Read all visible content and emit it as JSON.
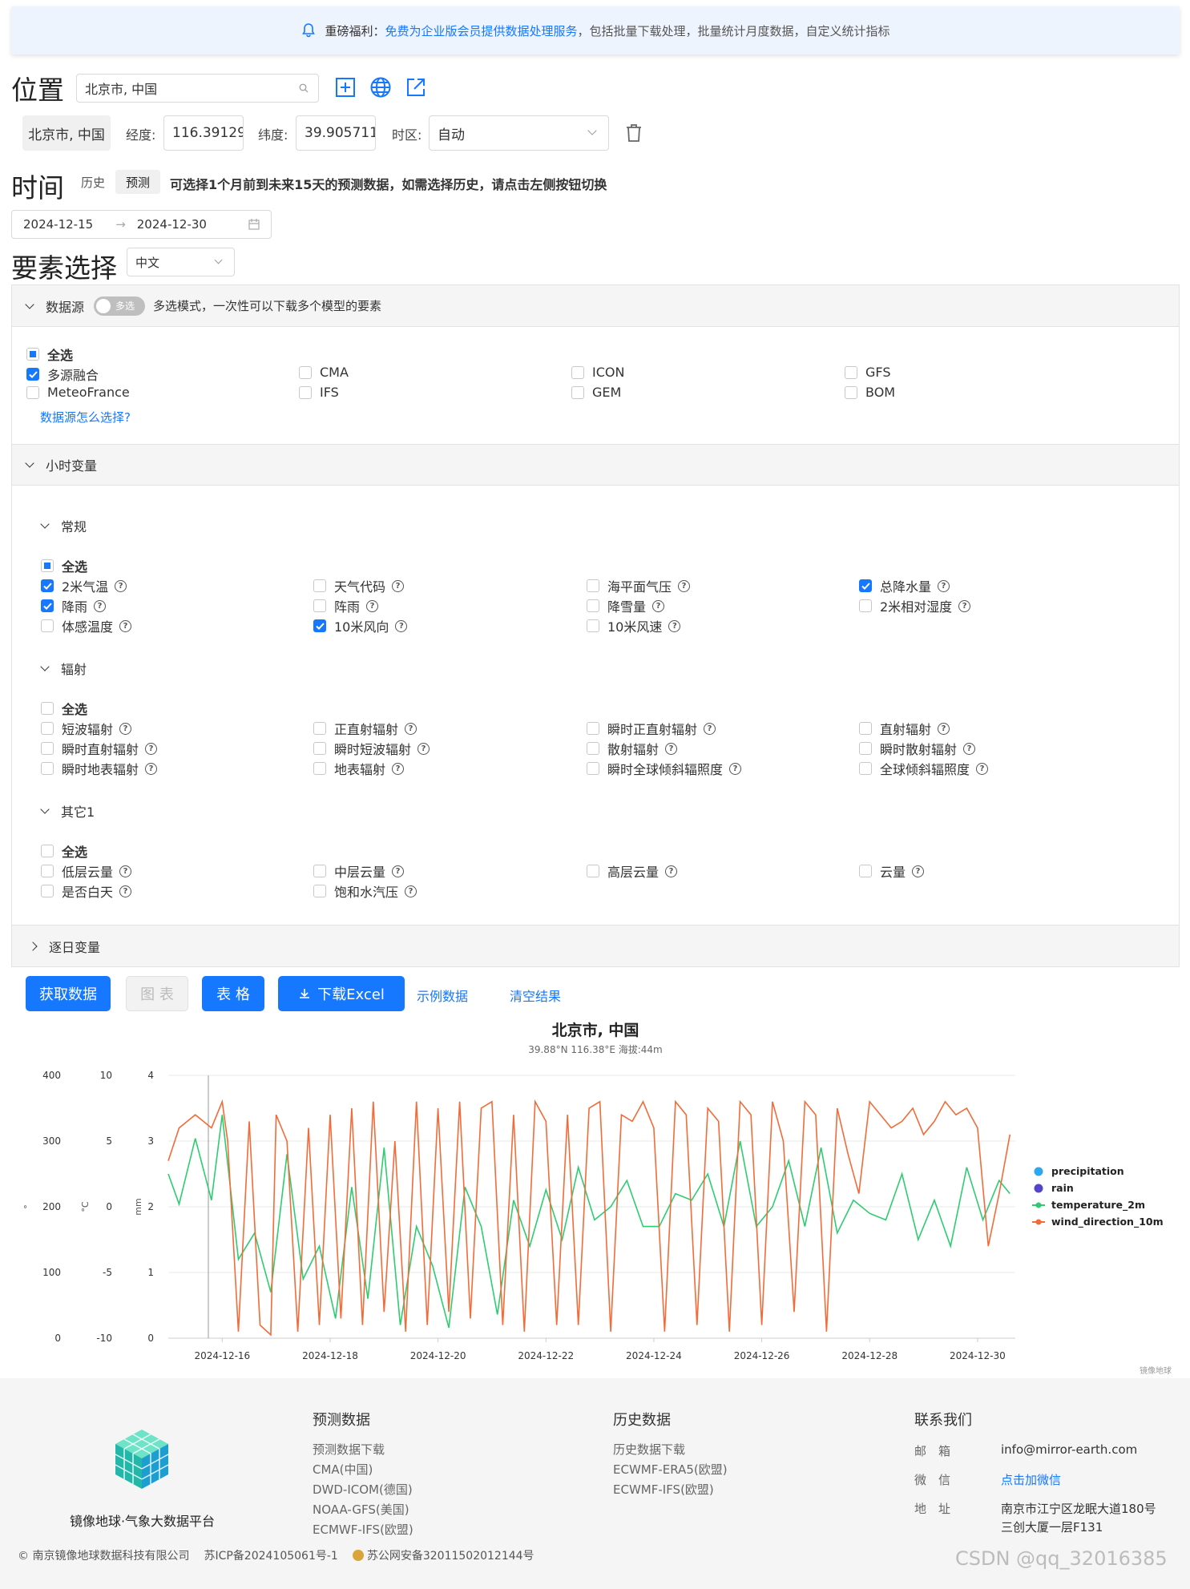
{
  "notice": {
    "lead": "重磅福利：",
    "highlight": "免费为企业版会员提供数据处理服务",
    "rest": "，包括批量下载处理，批量统计月度数据，自定义统计指标"
  },
  "location": {
    "title": "位置",
    "search_value": "北京市, 中国",
    "chip": "北京市, 中国",
    "lon_label": "经度:",
    "lon_value": "116.39129",
    "lat_label": "纬度:",
    "lat_value": "39.905711",
    "tz_label": "时区:",
    "tz_value": "自动"
  },
  "time": {
    "title": "时间",
    "tab_history": "历史",
    "tab_forecast": "预测",
    "hint": "可选择1个月前到未来15天的预测数据，如需选择历史，请点击左侧按钮切换",
    "start": "2024-12-15",
    "end": "2024-12-30",
    "arrow": "→"
  },
  "elements": {
    "title": "要素选择",
    "lang": "中文"
  },
  "datasource": {
    "title": "数据源",
    "toggle": "多选",
    "desc": "多选模式，一次性可以下载多个模型的要素",
    "select_all": "全选",
    "items": [
      "多源融合",
      "CMA",
      "ICON",
      "GFS",
      "MeteoFrance",
      "IFS",
      "GEM",
      "BOM"
    ],
    "help_link": "数据源怎么选择?"
  },
  "hourly": {
    "title": "小时变量",
    "general": {
      "title": "常规",
      "select_all": "全选",
      "items": [
        "2米气温",
        "天气代码",
        "海平面气压",
        "总降水量",
        "降雨",
        "阵雨",
        "降雪量",
        "2米相对湿度",
        "体感温度",
        "10米风向",
        "10米风速"
      ]
    },
    "radiation": {
      "title": "辐射",
      "select_all": "全选",
      "items": [
        "短波辐射",
        "正直射辐射",
        "瞬时正直射辐射",
        "直射辐射",
        "瞬时直射辐射",
        "瞬时短波辐射",
        "散射辐射",
        "瞬时散射辐射",
        "瞬时地表辐射",
        "地表辐射",
        "瞬时全球倾斜辐照度",
        "全球倾斜辐照度"
      ]
    },
    "other": {
      "title": "其它1",
      "select_all": "全选",
      "items": [
        "低层云量",
        "中层云量",
        "高层云量",
        "云量",
        "是否白天",
        "饱和水汽压"
      ]
    }
  },
  "daily": {
    "title": "逐日变量"
  },
  "actions": {
    "fetch": "获取数据",
    "chart": "图 表",
    "table": "表 格",
    "download": "下载Excel",
    "sample": "示例数据",
    "clear": "清空结果"
  },
  "chart_data": {
    "type": "line",
    "title": "北京市, 中国",
    "subtitle": "39.88°N 116.38°E 海拔:44m",
    "x_ticks": [
      "2024-12-16",
      "2024-12-18",
      "2024-12-20",
      "2024-12-22",
      "2024-12-24",
      "2024-12-26",
      "2024-12-28",
      "2024-12-30"
    ],
    "axes": [
      {
        "unit": "°",
        "ticks": [
          "400",
          "300",
          "200",
          "100",
          "0"
        ],
        "range": [
          0,
          400
        ]
      },
      {
        "unit": "°C",
        "ticks": [
          "10",
          "5",
          "0",
          "-5",
          "-10"
        ],
        "range": [
          -10,
          10
        ]
      },
      {
        "unit": "mm",
        "ticks": [
          "4",
          "3",
          "2",
          "1",
          "0"
        ],
        "range": [
          0,
          4
        ]
      }
    ],
    "series": [
      {
        "name": "precipitation",
        "color": "#2ea7f2",
        "values": []
      },
      {
        "name": "rain",
        "color": "#5446c8",
        "values": []
      },
      {
        "name": "temperature_2m",
        "color": "#2ecc71",
        "axis": 1,
        "x": [
          0,
          0.2,
          0.5,
          0.8,
          1.0,
          1.3,
          1.6,
          1.9,
          2.2,
          2.5,
          2.8,
          3.1,
          3.4,
          3.7,
          4.0,
          4.3,
          4.6,
          4.9,
          5.2,
          5.5,
          5.8,
          6.1,
          6.4,
          6.7,
          7.0,
          7.3,
          7.6,
          7.9,
          8.2,
          8.5,
          8.8,
          9.1,
          9.4,
          9.7,
          10.0,
          10.3,
          10.6,
          10.9,
          11.2,
          11.5,
          11.8,
          12.1,
          12.4,
          12.7,
          13.0,
          13.3,
          13.6,
          13.9,
          14.2,
          14.5,
          14.8,
          15.1,
          15.4,
          15.6
        ],
        "values": [
          2.5,
          0.2,
          5.2,
          0.5,
          7.0,
          -4.0,
          -2.0,
          -6.5,
          4.0,
          -5.5,
          -3.0,
          -8.5,
          1.5,
          -7.0,
          4.5,
          -9.0,
          -1.5,
          -4.5,
          -9.2,
          1.5,
          -1.5,
          -8.2,
          0.5,
          -3.0,
          1.3,
          -2.5,
          3.0,
          -1.0,
          0.0,
          2.0,
          -1.5,
          -1.5,
          1.0,
          0.5,
          2.5,
          -1.5,
          5.0,
          -1.5,
          0.0,
          3.5,
          -1.5,
          4.5,
          -2.0,
          0.5,
          -0.5,
          -1.0,
          2.5,
          -2.5,
          0.5,
          -3.0,
          3.0,
          -1.0,
          2.0,
          1.0
        ]
      },
      {
        "name": "wind_direction_10m",
        "color": "#f26b38",
        "axis": 0,
        "x": [
          0,
          0.2,
          0.5,
          0.8,
          1.0,
          1.1,
          1.3,
          1.5,
          1.7,
          1.9,
          2.0,
          2.2,
          2.4,
          2.6,
          2.8,
          3.0,
          3.2,
          3.4,
          3.6,
          3.8,
          4.0,
          4.2,
          4.4,
          4.6,
          4.8,
          5.0,
          5.2,
          5.4,
          5.6,
          5.8,
          6.0,
          6.2,
          6.4,
          6.6,
          6.8,
          7.0,
          7.2,
          7.4,
          7.6,
          7.8,
          8.0,
          8.2,
          8.4,
          8.6,
          8.8,
          9.0,
          9.2,
          9.4,
          9.6,
          9.8,
          10.0,
          10.2,
          10.4,
          10.6,
          10.8,
          11.0,
          11.2,
          11.4,
          11.6,
          11.8,
          12.0,
          12.2,
          12.4,
          12.6,
          12.8,
          13.0,
          13.2,
          13.4,
          13.6,
          13.8,
          14.0,
          14.2,
          14.4,
          14.6,
          14.8,
          15.0,
          15.2,
          15.4,
          15.6
        ],
        "values": [
          270,
          320,
          340,
          320,
          360,
          300,
          10,
          330,
          20,
          5,
          340,
          300,
          10,
          320,
          20,
          340,
          30,
          350,
          20,
          360,
          40,
          300,
          10,
          360,
          20,
          350,
          40,
          360,
          30,
          350,
          360,
          20,
          340,
          10,
          360,
          330,
          20,
          340,
          20,
          350,
          360,
          10,
          340,
          330,
          360,
          320,
          10,
          360,
          340,
          20,
          350,
          330,
          10,
          360,
          340,
          20,
          360,
          300,
          40,
          360,
          340,
          10,
          350,
          280,
          220,
          360,
          340,
          320,
          330,
          350,
          310,
          330,
          360,
          340,
          350,
          320,
          140,
          220,
          310
        ]
      }
    ],
    "legend_position": "right"
  },
  "chart_credit": "镜像地球",
  "footer": {
    "brand": "镜像地球·气象大数据平台",
    "col1": {
      "title": "预测数据",
      "items": [
        "预测数据下载",
        "CMA(中国)",
        "DWD-ICOM(德国)",
        "NOAA-GFS(美国)",
        "ECMWF-IFS(欧盟)"
      ]
    },
    "col2": {
      "title": "历史数据",
      "items": [
        "历史数据下载",
        "ECWMF-ERA5(欧盟)",
        "ECWMF-IFS(欧盟)"
      ]
    },
    "col3": {
      "title": "联系我们",
      "email_label": "邮　箱",
      "email": "info@mirror-earth.com",
      "wechat_label": "微　信",
      "wechat": "点击加微信",
      "addr_label": "地　址",
      "addr1": "南京市江宁区龙眠大道180号",
      "addr2": "三创大厦一层F131"
    },
    "copyright": "© 南京镜像地球数据科技有限公司",
    "icp": "苏ICP备2024105061号-1",
    "police": "苏公网安备32011502012144号"
  },
  "watermark": "CSDN @qq_32016385"
}
